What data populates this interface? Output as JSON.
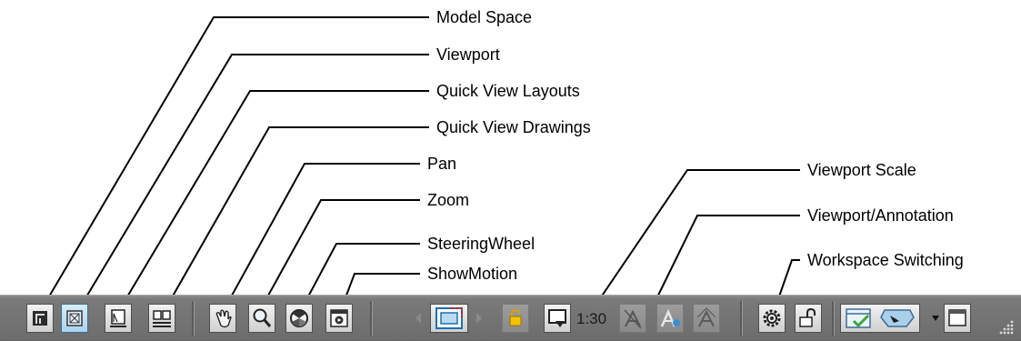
{
  "callouts": [
    {
      "label": "Model Space"
    },
    {
      "label": "Viewport"
    },
    {
      "label": "Quick View Layouts"
    },
    {
      "label": "Quick View Drawings"
    },
    {
      "label": "Pan"
    },
    {
      "label": "Zoom"
    },
    {
      "label": "SteeringWheel"
    },
    {
      "label": "ShowMotion"
    },
    {
      "label": "Viewport Scale"
    },
    {
      "label": "Viewport/Annotation"
    },
    {
      "label": "Workspace Switching"
    }
  ],
  "statusbar": {
    "viewport_scale": "1:30",
    "icons": [
      "model-space-icon",
      "viewport-icon",
      "quick-view-layouts-icon",
      "quick-view-drawings-icon",
      "pan-icon",
      "zoom-icon",
      "steeringwheel-icon",
      "showmotion-icon",
      "prev-arrow-icon",
      "maximize-viewport-icon",
      "next-arrow-icon",
      "lock-icon",
      "viewport-scale-icon",
      "annotation-visibility-icon",
      "annotation-autoscale-icon",
      "annotation-scale-icon",
      "workspace-gear-icon",
      "toolbar-lock-icon",
      "palette-icon",
      "dropdown-arrow-icon",
      "clean-screen-icon",
      "resize-grip-icon"
    ],
    "colors": {
      "bar": "#6d6d6d",
      "button": "#dcdcdc",
      "active": "#b7ddf2",
      "lock": "#e0a000",
      "check": "#3da53d"
    }
  }
}
